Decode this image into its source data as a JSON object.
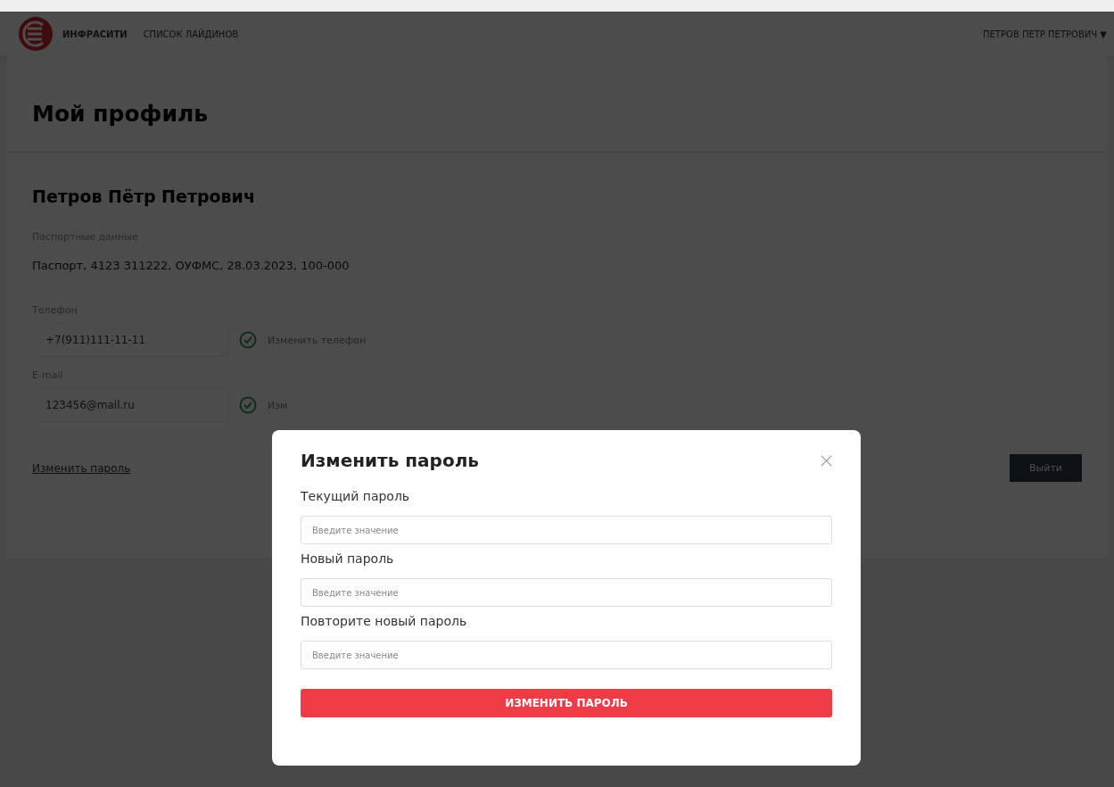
{
  "header": {
    "logo_text": "ИНФРАСИТИ",
    "nav_link": "СПИСОК ЛАЙДИНОВ",
    "user_menu": "ПЕТРОВ ПЕТР ПЕТРОВИЧ",
    "user_menu_caret": "▼"
  },
  "page": {
    "title": "Мой профиль",
    "full_name": "Петров Пётр Петрович",
    "passport_label": "Паспортные данные",
    "passport_value": "Паспорт, 4123 311222, ОУФМС, 28.03.2023, 100-000",
    "contacts": [
      {
        "label": "Телефон",
        "value": "+7(911)111-11-11",
        "verified": true,
        "action": "Изменить телефон"
      },
      {
        "label": "E-mail",
        "value": "123456@mail.ru",
        "verified": true,
        "action": "Изм"
      }
    ],
    "change_password_link": "Изменить пароль",
    "action_button": "Выйти"
  },
  "modal": {
    "title": "Изменить пароль",
    "fields": [
      {
        "label": "Текущий пароль",
        "placeholder": "Введите значение"
      },
      {
        "label": "Новый пароль",
        "placeholder": "Введите значение"
      },
      {
        "label": "Повторите новый пароль",
        "placeholder": "Введите значение"
      }
    ],
    "submit": "ИЗМЕНИТЬ ПАРОЛЬ"
  }
}
